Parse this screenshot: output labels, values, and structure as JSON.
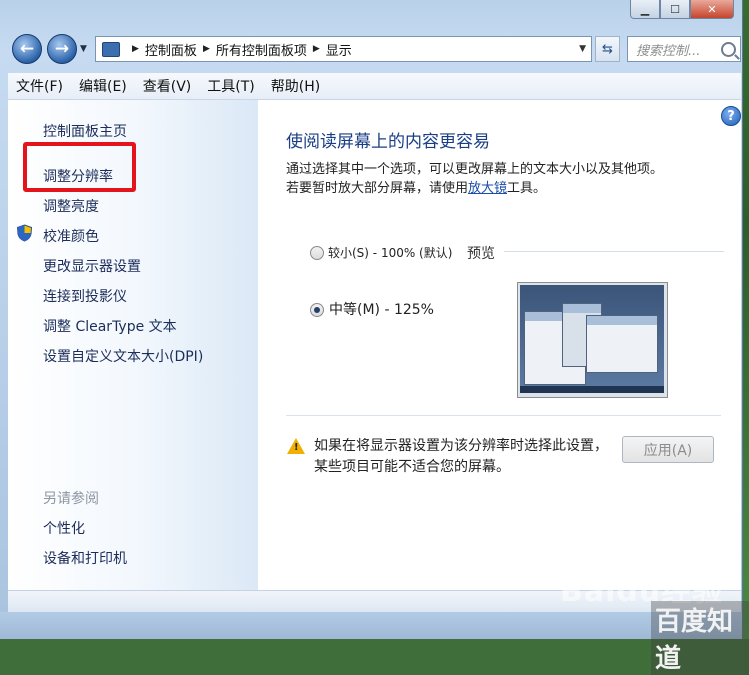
{
  "nav": {
    "breadcrumbs": [
      "控制面板",
      "所有控制面板项",
      "显示"
    ],
    "search_placeholder": "搜索控制..."
  },
  "menu": [
    "文件(F)",
    "编辑(E)",
    "查看(V)",
    "工具(T)",
    "帮助(H)"
  ],
  "sidebar": {
    "links": [
      "控制面板主页",
      "调整分辨率",
      "调整亮度",
      "校准颜色",
      "更改显示器设置",
      "连接到投影仪",
      "调整 ClearType 文本",
      "设置自定义文本大小(DPI)"
    ],
    "see_also_title": "另请参阅",
    "see_also": [
      "个性化",
      "设备和打印机"
    ]
  },
  "main": {
    "title": "使阅读屏幕上的内容更容易",
    "desc_line1": "通过选择其中一个选项，可以更改屏幕上的文本大小以及其他项。",
    "desc_line2_prefix": "若要暂时放大部分屏幕，请使用",
    "desc_link": "放大镜",
    "desc_line2_suffix": "工具。",
    "options": [
      {
        "label": "较小(S) - 100% (默认)",
        "selected": false
      },
      {
        "label": "中等(M) - 125%",
        "selected": true
      }
    ],
    "preview_label": "预览",
    "warning": "如果在将显示器设置为该分辨率时选择此设置，某些项目可能不适合您的屏幕。",
    "apply_label": "应用(A)"
  },
  "watermark": {
    "text": "Baidu经验",
    "sub": "百度知道"
  },
  "colors": {
    "highlight_box": "#e3141b",
    "link": "#1c2d5a",
    "title": "#1a3e86"
  }
}
